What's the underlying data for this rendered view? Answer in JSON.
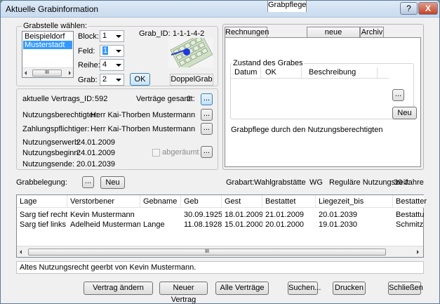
{
  "window": {
    "title": "Aktuelle Grabinformation",
    "help_label": "?",
    "close_label": "X"
  },
  "grabstelle": {
    "group_label": "Grabstelle wählen:",
    "cemeteries": [
      "Beispieldorf",
      "Musterstadt"
    ],
    "selected_cemetery": "Musterstadt",
    "block_label": "Block:",
    "block_value": "1",
    "feld_label": "Feld:",
    "feld_value": "1",
    "reihe_label": "Reihe:",
    "reihe_value": "4",
    "grab_label": "Grab:",
    "grab_value": "2",
    "ok_label": "OK",
    "grab_id_label": "Grab_ID:",
    "grab_id_value": "1-1-1-4-2",
    "grave_type": "DoppelGrab",
    "scroll_thumb": "III"
  },
  "vertrag": {
    "vertrags_id_label": "aktuelle Vertrags_ID:",
    "vertrags_id_value": "592",
    "gesamt_label": "Verträge gesamt:",
    "gesamt_value": "2",
    "nutzungsberechtigter_label": "Nutzungsberechtigter:",
    "nutzungsberechtigter_value": "Herr  Kai-Thorben Mustermann",
    "zahlungspflichtiger_label": "Zahlungspflichtiger:",
    "zahlungspflichtiger_value": "Herr  Kai-Thorben Mustermann",
    "erwerb_label": "Nutzungserwerb:",
    "erwerb_value": "24.01.2009",
    "beginn_label": "Nutzungsbeginn:",
    "beginn_value": "24.01.2009",
    "ende_label": "Nutzungsende:",
    "ende_value": "20.01.2039",
    "abgeraeumt_label": "abgeräumt",
    "dots_label": "..."
  },
  "tabs": {
    "items": [
      "Rechnungen",
      "Grabpflege",
      "neue Dokumente",
      "Archiv"
    ],
    "active": "Grabpflege",
    "zustand_label": "Zustand des Grabes",
    "columns": [
      "Datum",
      "OK",
      "Beschreibung"
    ],
    "dots_label": "...",
    "neu_label": "Neu",
    "note": "Grabpflege durch den Nutzungsberechtigten"
  },
  "belegung": {
    "label": "Grabbelegung:",
    "dots_label": "...",
    "neu_label": "Neu",
    "grabart_label": "Grabart:",
    "grabart_value": "Wahlgrabstätte",
    "wg_label": "WG",
    "ruhezeit_label": "Reguläre Nutzungszeit:",
    "ruhezeit_value": "30 Jahre",
    "columns": [
      "Lage",
      "Verstorbener",
      "Gebname",
      "Geb",
      "Gest",
      "Bestattet",
      "Liegezeit_bis",
      "Bestatter"
    ],
    "rows": [
      [
        "Sarg tief rechts",
        "Kevin Mustermann",
        "",
        "30.09.1925",
        "18.01.2009",
        "21.01.2009",
        "20.01.2039",
        "Bestattun"
      ],
      [
        "Sarg tief links",
        "Adelheid Mustermann",
        "Lange",
        "11.08.1928",
        "15.01.2000",
        "20.01.2000",
        "19.01.2030",
        "Schmitz u"
      ]
    ],
    "scroll_thumb": "III",
    "status": "Altes Nutzungsrecht geerbt von Kevin Mustermann."
  },
  "footer": {
    "vertrag_aendern": "Vertrag ändern",
    "neuer_vertrag": "Neuer Vertrag",
    "alle_vertraege": "Alle Verträge",
    "suchen": "Suchen...",
    "drucken": "Drucken",
    "schliessen": "Schließen"
  }
}
